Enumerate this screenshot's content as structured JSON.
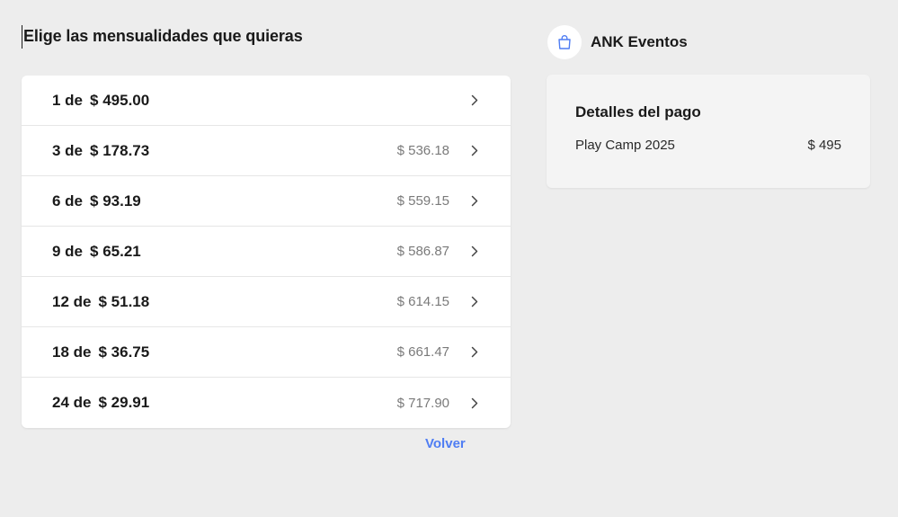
{
  "page": {
    "title": "Elige las mensualidades que quieras",
    "back_label": "Volver"
  },
  "plans": [
    {
      "count": "1 de",
      "amount": "$ 495.00",
      "total": ""
    },
    {
      "count": "3 de",
      "amount": "$ 178.73",
      "total": "$ 536.18"
    },
    {
      "count": "6 de",
      "amount": "$ 93.19",
      "total": "$ 559.15"
    },
    {
      "count": "9 de",
      "amount": "$ 65.21",
      "total": "$ 586.87"
    },
    {
      "count": "12 de",
      "amount": "$ 51.18",
      "total": "$ 614.15"
    },
    {
      "count": "18 de",
      "amount": "$ 36.75",
      "total": "$ 661.47"
    },
    {
      "count": "24 de",
      "amount": "$ 29.91",
      "total": "$ 717.90"
    }
  ],
  "merchant": {
    "name": "ANK Eventos",
    "logo_icon": "shopping-bag-icon"
  },
  "details": {
    "title": "Detalles del pago",
    "item_name": "Play Camp 2025",
    "item_price": "$ 495"
  },
  "colors": {
    "accent": "#4f7df3",
    "background": "#ededed",
    "card": "#ffffff",
    "muted_text": "#7a7a7a"
  }
}
